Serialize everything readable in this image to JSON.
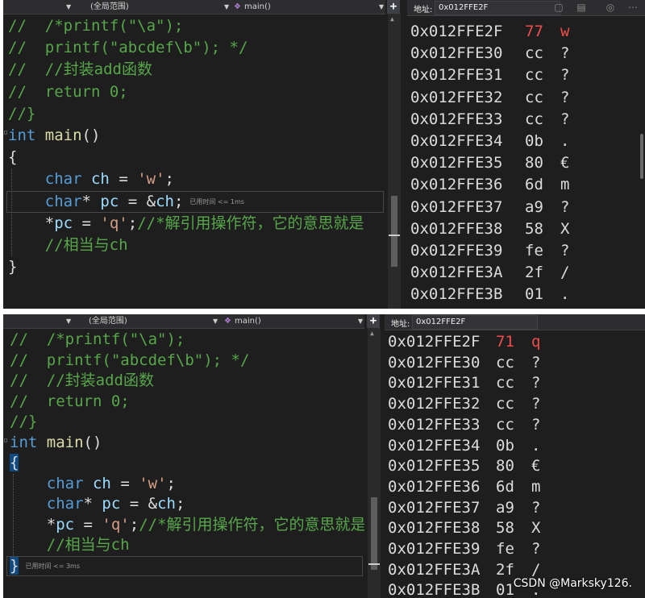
{
  "navbar": {
    "scope": "(全局范围)",
    "function": "main()"
  },
  "editor": {
    "lines": [
      [
        {
          "t": "//  ",
          "c": "cmt"
        },
        {
          "t": "/*printf(\"\\a\");",
          "c": "cmt"
        }
      ],
      [
        {
          "t": "//  ",
          "c": "cmt"
        },
        {
          "t": "printf(\"abcdef\\b\"); */",
          "c": "cmt"
        }
      ],
      [
        {
          "t": "//  ",
          "c": "cmt"
        },
        {
          "t": "//封装add函数",
          "c": "cmt"
        }
      ],
      [
        {
          "t": "//  ",
          "c": "cmt"
        },
        {
          "t": "return 0;",
          "c": "cmt"
        }
      ],
      [
        {
          "t": "//}",
          "c": "cmt"
        }
      ],
      [
        {
          "t": "int",
          "c": "kw"
        },
        {
          "t": " ",
          "c": "txt"
        },
        {
          "t": "main",
          "c": "fn"
        },
        {
          "t": "()",
          "c": "txt"
        }
      ],
      [
        {
          "t": "{",
          "c": "brace"
        }
      ],
      [
        {
          "t": "    ",
          "c": "txt"
        },
        {
          "t": "char",
          "c": "kw"
        },
        {
          "t": " ",
          "c": "txt"
        },
        {
          "t": "ch",
          "c": "var"
        },
        {
          "t": " = ",
          "c": "txt"
        },
        {
          "t": "'w'",
          "c": "str"
        },
        {
          "t": ";",
          "c": "txt"
        }
      ],
      [
        {
          "t": "    ",
          "c": "txt"
        },
        {
          "t": "char",
          "c": "kw"
        },
        {
          "t": "* ",
          "c": "txt"
        },
        {
          "t": "pc",
          "c": "var"
        },
        {
          "t": " = &",
          "c": "txt"
        },
        {
          "t": "ch",
          "c": "var"
        },
        {
          "t": ";",
          "c": "txt"
        }
      ],
      [
        {
          "t": "    *",
          "c": "txt"
        },
        {
          "t": "pc",
          "c": "var"
        },
        {
          "t": " = ",
          "c": "txt"
        },
        {
          "t": "'q'",
          "c": "str"
        },
        {
          "t": ";",
          "c": "txt"
        },
        {
          "t": "//*解引用操作符，它的意思就是",
          "c": "cmt"
        }
      ],
      [
        {
          "t": "    ",
          "c": "txt"
        },
        {
          "t": "//相当与ch",
          "c": "cmt"
        }
      ],
      [
        {
          "t": "}",
          "c": "brace"
        }
      ]
    ],
    "top_hint": "已用时间 <= 1ms",
    "bottom_hint": "已用时间 <= 3ms"
  },
  "memory": {
    "address_label": "地址:",
    "address_value": "0x012FFE2F",
    "top_rows": [
      {
        "addr": "0x012FFE2F",
        "hex": "77",
        "chr": "w",
        "changed": true
      },
      {
        "addr": "0x012FFE30",
        "hex": "cc",
        "chr": "?",
        "changed": false
      },
      {
        "addr": "0x012FFE31",
        "hex": "cc",
        "chr": "?",
        "changed": false
      },
      {
        "addr": "0x012FFE32",
        "hex": "cc",
        "chr": "?",
        "changed": false
      },
      {
        "addr": "0x012FFE33",
        "hex": "cc",
        "chr": "?",
        "changed": false
      },
      {
        "addr": "0x012FFE34",
        "hex": "0b",
        "chr": ".",
        "changed": false
      },
      {
        "addr": "0x012FFE35",
        "hex": "80",
        "chr": "€",
        "changed": false
      },
      {
        "addr": "0x012FFE36",
        "hex": "6d",
        "chr": "m",
        "changed": false
      },
      {
        "addr": "0x012FFE37",
        "hex": "a9",
        "chr": "?",
        "changed": false
      },
      {
        "addr": "0x012FFE38",
        "hex": "58",
        "chr": "X",
        "changed": false
      },
      {
        "addr": "0x012FFE39",
        "hex": "fe",
        "chr": "?",
        "changed": false
      },
      {
        "addr": "0x012FFE3A",
        "hex": "2f",
        "chr": "/",
        "changed": false
      },
      {
        "addr": "0x012FFE3B",
        "hex": "01",
        "chr": ".",
        "changed": false
      }
    ],
    "bottom_rows": [
      {
        "addr": "0x012FFE2F",
        "hex": "71",
        "chr": "q",
        "changed": true
      },
      {
        "addr": "0x012FFE30",
        "hex": "cc",
        "chr": "?",
        "changed": false
      },
      {
        "addr": "0x012FFE31",
        "hex": "cc",
        "chr": "?",
        "changed": false
      },
      {
        "addr": "0x012FFE32",
        "hex": "cc",
        "chr": "?",
        "changed": false
      },
      {
        "addr": "0x012FFE33",
        "hex": "cc",
        "chr": "?",
        "changed": false
      },
      {
        "addr": "0x012FFE34",
        "hex": "0b",
        "chr": ".",
        "changed": false
      },
      {
        "addr": "0x012FFE35",
        "hex": "80",
        "chr": "€",
        "changed": false
      },
      {
        "addr": "0x012FFE36",
        "hex": "6d",
        "chr": "m",
        "changed": false
      },
      {
        "addr": "0x012FFE37",
        "hex": "a9",
        "chr": "?",
        "changed": false
      },
      {
        "addr": "0x012FFE38",
        "hex": "58",
        "chr": "X",
        "changed": false
      },
      {
        "addr": "0x012FFE39",
        "hex": "fe",
        "chr": "?",
        "changed": false
      },
      {
        "addr": "0x012FFE3A",
        "hex": "2f",
        "chr": "/",
        "changed": false
      },
      {
        "addr": "0x012FFE3B",
        "hex": "01",
        "chr": ".",
        "changed": false
      }
    ]
  },
  "watermark": "CSDN @Marksky126.",
  "icons": {
    "function": "cube-icon",
    "split": "plus-icon",
    "dropdown": "chevron-down-icon"
  }
}
